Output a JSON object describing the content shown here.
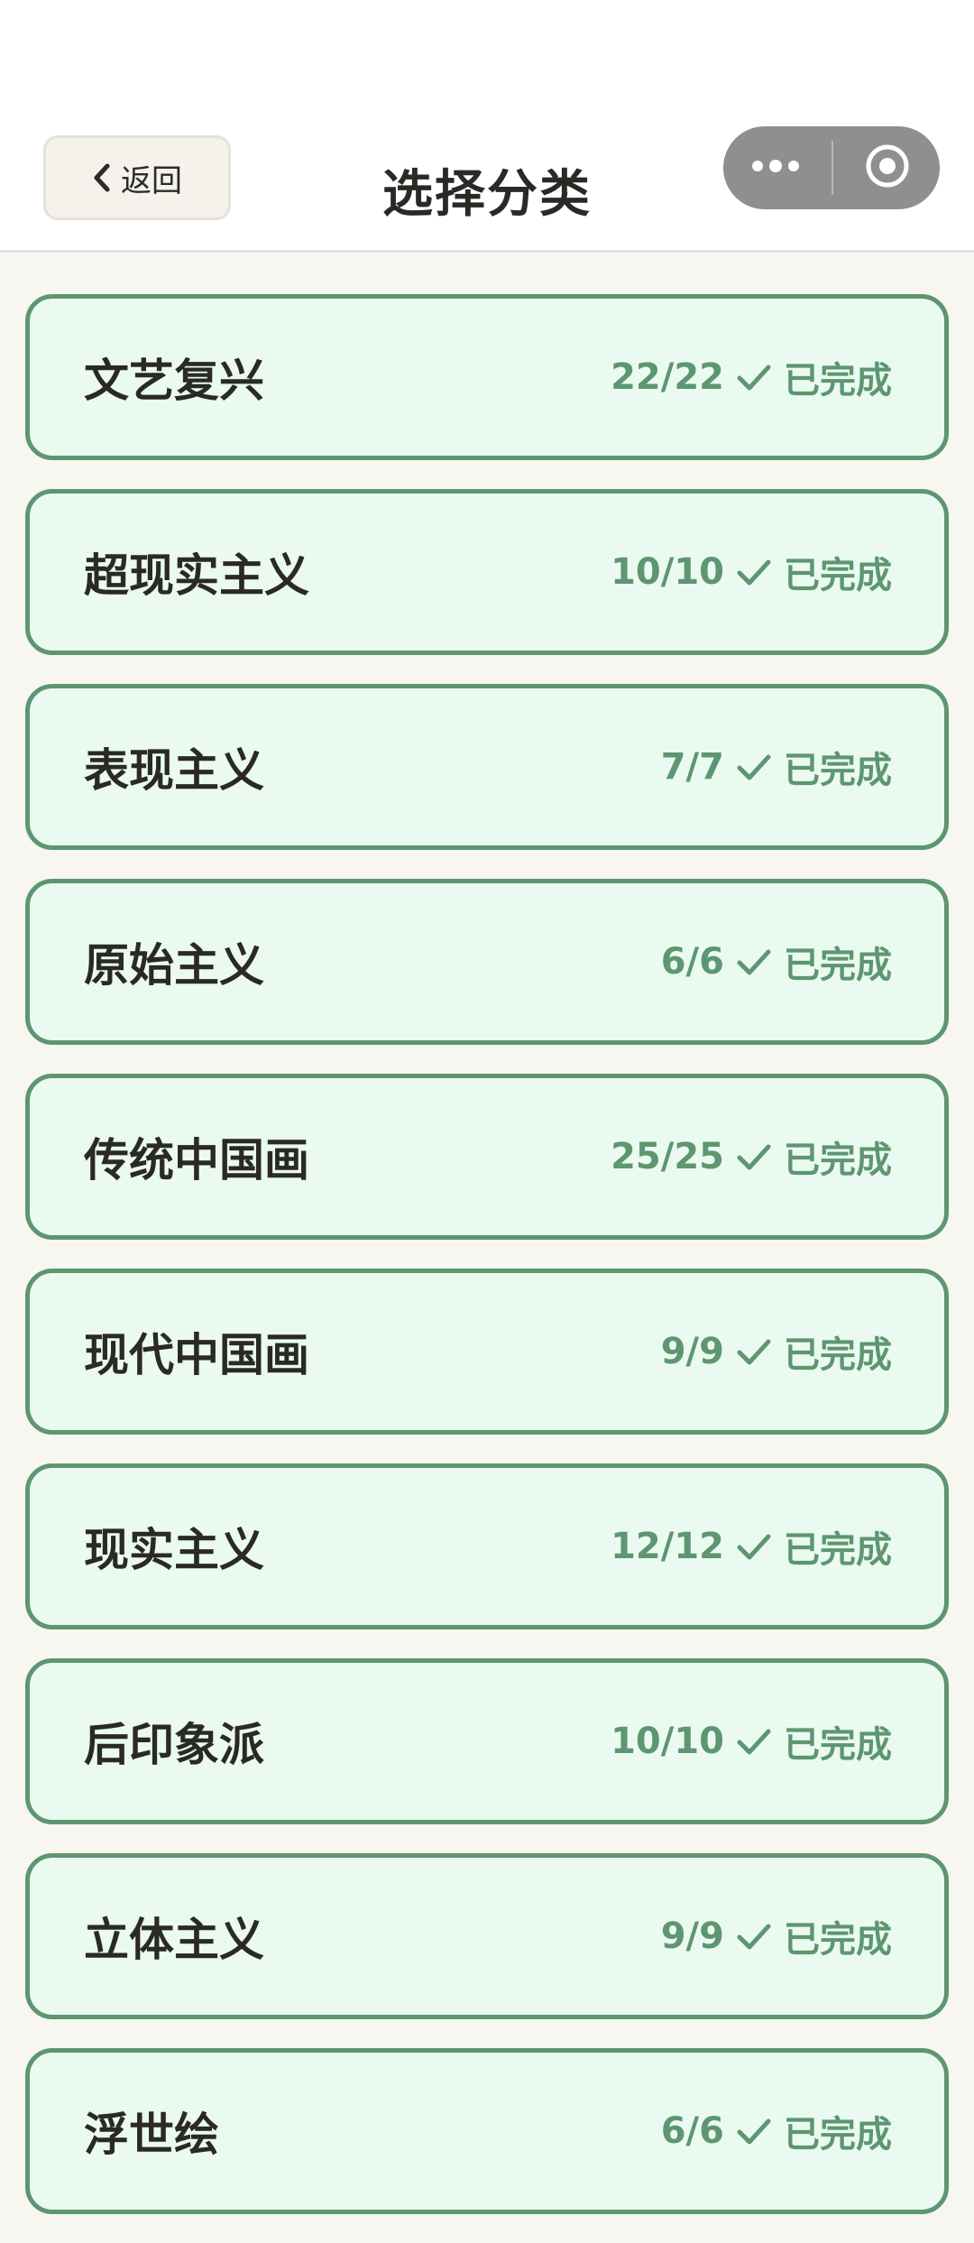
{
  "header": {
    "back_label": "返回",
    "title": "选择分类"
  },
  "accent_color": "#5d9670",
  "categories": [
    {
      "name": "文艺复兴",
      "progress": "22/22",
      "status": "已完成"
    },
    {
      "name": "超现实主义",
      "progress": "10/10",
      "status": "已完成"
    },
    {
      "name": "表现主义",
      "progress": "7/7",
      "status": "已完成"
    },
    {
      "name": "原始主义",
      "progress": "6/6",
      "status": "已完成"
    },
    {
      "name": "传统中国画",
      "progress": "25/25",
      "status": "已完成"
    },
    {
      "name": "现代中国画",
      "progress": "9/9",
      "status": "已完成"
    },
    {
      "name": "现实主义",
      "progress": "12/12",
      "status": "已完成"
    },
    {
      "name": "后印象派",
      "progress": "10/10",
      "status": "已完成"
    },
    {
      "name": "立体主义",
      "progress": "9/9",
      "status": "已完成"
    },
    {
      "name": "浮世绘",
      "progress": "6/6",
      "status": "已完成"
    }
  ],
  "icons": {
    "back": "chevron-left-icon",
    "more": "more-icon",
    "close": "target-icon",
    "check": "check-icon"
  }
}
